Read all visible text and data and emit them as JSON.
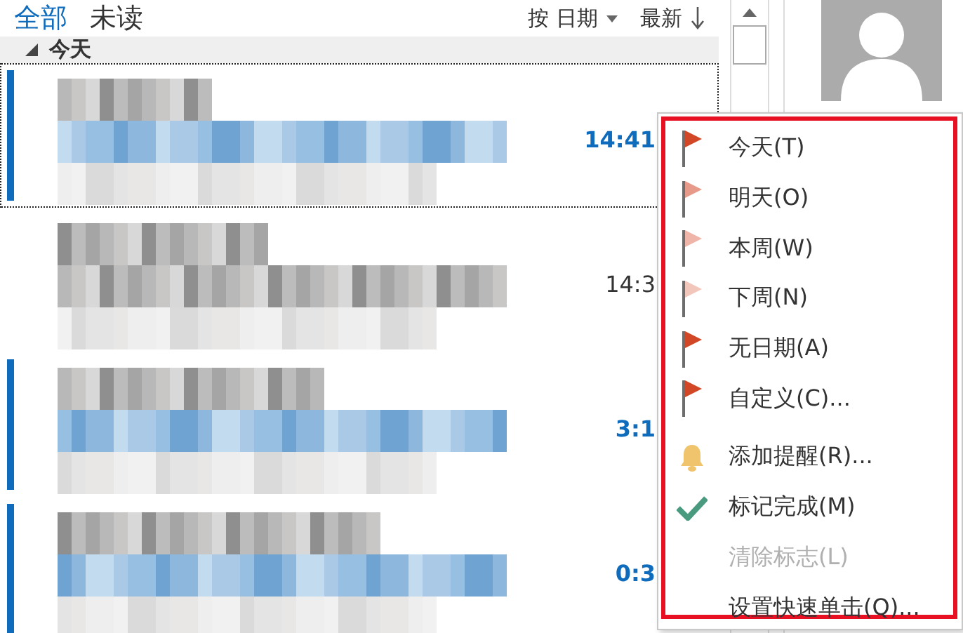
{
  "filters": [
    {
      "label": "全部",
      "selected": true
    },
    {
      "label": "未读",
      "selected": false
    }
  ],
  "sort": {
    "by": "按 日期",
    "order": "最新"
  },
  "group": {
    "label": "今天",
    "expanded": true
  },
  "messages": [
    {
      "unread": true,
      "focused": true,
      "time": "14:41"
    },
    {
      "unread": false,
      "focused": false,
      "time": "14:3"
    },
    {
      "unread": true,
      "focused": false,
      "time": "3:1"
    },
    {
      "unread": true,
      "focused": false,
      "time": "0:3"
    }
  ],
  "menu": [
    {
      "kind": "flag",
      "label": "今天(T)",
      "color": "#d24726",
      "disabled": false
    },
    {
      "kind": "flag",
      "label": "明天(O)",
      "color": "#e89a8a",
      "disabled": false
    },
    {
      "kind": "flag",
      "label": "本周(W)",
      "color": "#efb5a8",
      "disabled": false
    },
    {
      "kind": "flag",
      "label": "下周(N)",
      "color": "#f3c6bb",
      "disabled": false
    },
    {
      "kind": "flag",
      "label": "无日期(A)",
      "color": "#d24726",
      "disabled": false
    },
    {
      "kind": "flag",
      "label": "自定义(C)...",
      "color": "#d24726",
      "disabled": false
    },
    {
      "kind": "separator"
    },
    {
      "kind": "bell",
      "label": "添加提醒(R)...",
      "disabled": false
    },
    {
      "kind": "check",
      "label": "标记完成(M)",
      "disabled": false
    },
    {
      "kind": "plain",
      "label": "清除标志(L)",
      "disabled": true
    },
    {
      "kind": "plain",
      "label": "设置快速单击(Q)...",
      "disabled": false
    }
  ]
}
